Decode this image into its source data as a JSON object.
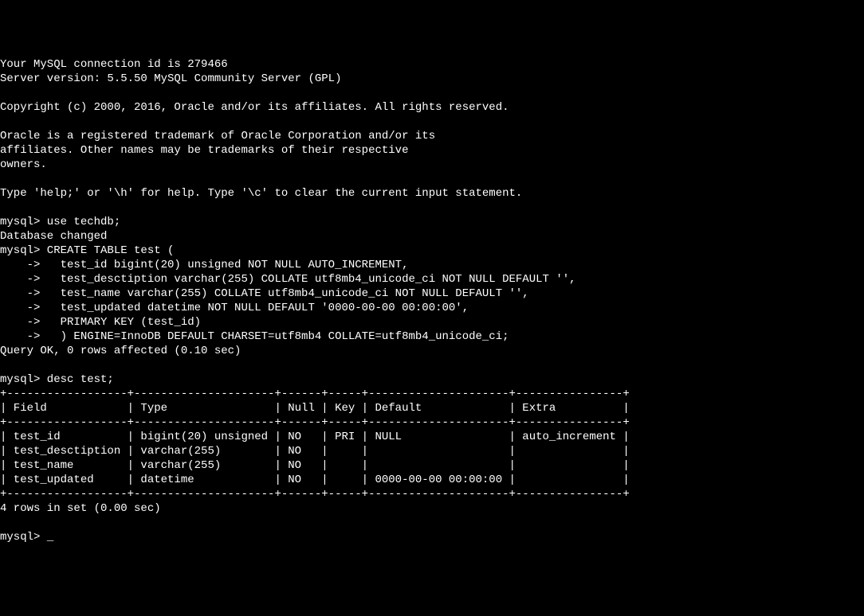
{
  "lines": {
    "conn_id": "Your MySQL connection id is 279466",
    "server_version": "Server version: 5.5.50 MySQL Community Server (GPL)",
    "blank1": "",
    "copyright": "Copyright (c) 2000, 2016, Oracle and/or its affiliates. All rights reserved.",
    "blank2": "",
    "trademark1": "Oracle is a registered trademark of Oracle Corporation and/or its",
    "trademark2": "affiliates. Other names may be trademarks of their respective",
    "trademark3": "owners.",
    "blank3": "",
    "help": "Type 'help;' or '\\h' for help. Type '\\c' to clear the current input statement.",
    "blank4": "",
    "cmd_use": "mysql> use techdb;",
    "db_changed": "Database changed",
    "cmd_create": "mysql> CREATE TABLE test (",
    "cmd_create2": "    ->   test_id bigint(20) unsigned NOT NULL AUTO_INCREMENT,",
    "cmd_create3": "    ->   test_desctiption varchar(255) COLLATE utf8mb4_unicode_ci NOT NULL DEFAULT '',",
    "cmd_create4": "    ->   test_name varchar(255) COLLATE utf8mb4_unicode_ci NOT NULL DEFAULT '',",
    "cmd_create5": "    ->   test_updated datetime NOT NULL DEFAULT '0000-00-00 00:00:00',",
    "cmd_create6": "    ->   PRIMARY KEY (test_id)",
    "cmd_create7": "    ->   ) ENGINE=InnoDB DEFAULT CHARSET=utf8mb4 COLLATE=utf8mb4_unicode_ci;",
    "query_ok": "Query OK, 0 rows affected (0.10 sec)",
    "blank5": "",
    "cmd_desc": "mysql> desc test;",
    "table_border_top": "+------------------+---------------------+------+-----+---------------------+----------------+",
    "table_header": "| Field            | Type                | Null | Key | Default             | Extra          |",
    "table_border_mid": "+------------------+---------------------+------+-----+---------------------+----------------+",
    "table_row1": "| test_id          | bigint(20) unsigned | NO   | PRI | NULL                | auto_increment |",
    "table_row2": "| test_desctiption | varchar(255)        | NO   |     |                     |                |",
    "table_row3": "| test_name        | varchar(255)        | NO   |     |                     |                |",
    "table_row4": "| test_updated     | datetime            | NO   |     | 0000-00-00 00:00:00 |                |",
    "table_border_bot": "+------------------+---------------------+------+-----+---------------------+----------------+",
    "rows_in_set": "4 rows in set (0.00 sec)",
    "blank7": "",
    "prompt": "mysql> "
  },
  "cursor": "_"
}
